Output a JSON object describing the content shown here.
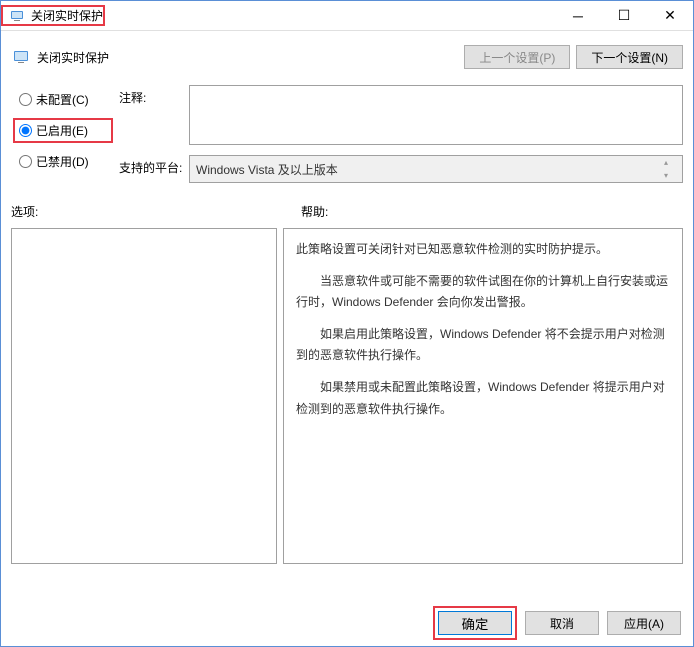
{
  "titlebar": {
    "title": "关闭实时保护"
  },
  "header": {
    "title": "关闭实时保护",
    "prev_label": "上一个设置(P)",
    "next_label": "下一个设置(N)"
  },
  "radios": {
    "not_configured": "未配置(C)",
    "enabled": "已启用(E)",
    "disabled": "已禁用(D)",
    "selected": "enabled"
  },
  "fields": {
    "comment_label": "注释:",
    "comment_value": "",
    "platform_label": "支持的平台:",
    "platform_value": "Windows Vista 及以上版本"
  },
  "panes": {
    "options_label": "选项:",
    "help_label": "帮助:",
    "help_paragraphs": [
      "此策略设置可关闭针对已知恶意软件检测的实时防护提示。",
      "当恶意软件或可能不需要的软件试图在你的计算机上自行安装或运行时，Windows Defender 会向你发出警报。",
      "如果启用此策略设置，Windows Defender 将不会提示用户对检测到的恶意软件执行操作。",
      "如果禁用或未配置此策略设置，Windows Defender 将提示用户对检测到的恶意软件执行操作。"
    ]
  },
  "footer": {
    "ok": "确定",
    "cancel": "取消",
    "apply": "应用(A)"
  }
}
